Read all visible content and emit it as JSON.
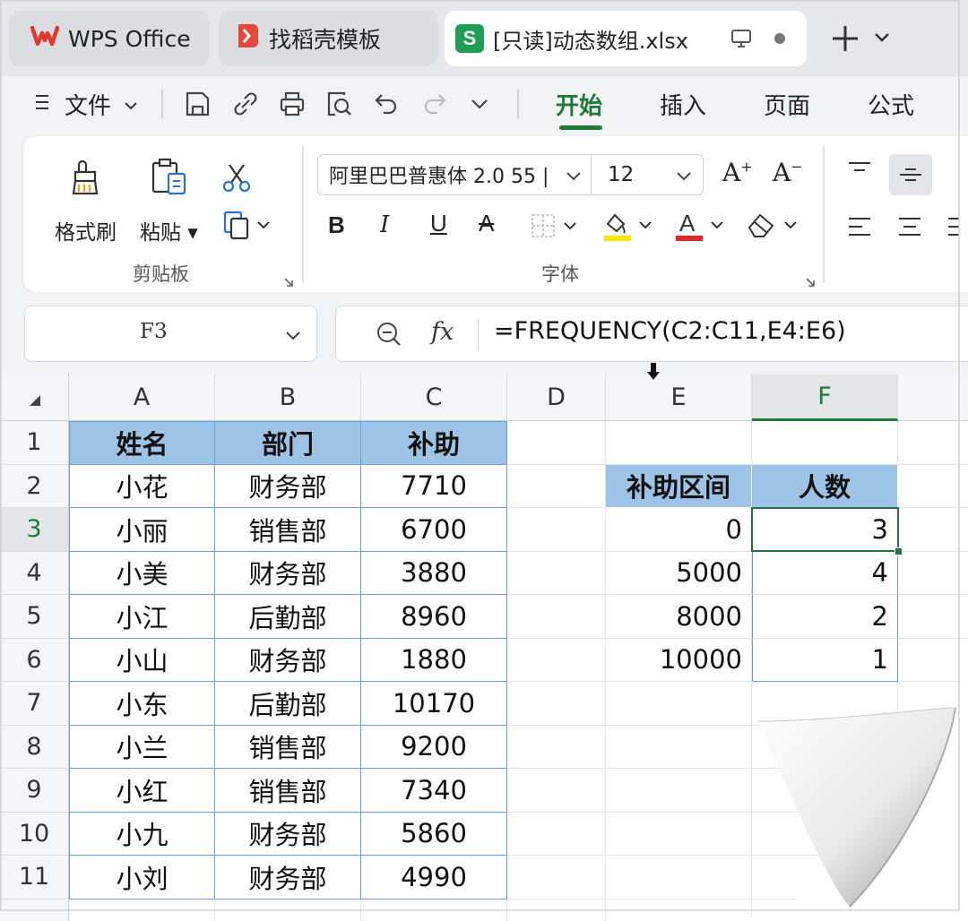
{
  "tabs": [
    {
      "label": "WPS Office",
      "icon": "wps-logo-icon"
    },
    {
      "label": "找稻壳模板",
      "icon": "docer-logo-icon"
    },
    {
      "label": "[只读]动态数组.xlsx",
      "icon": "spreadsheet-s-icon",
      "badge": "S"
    }
  ],
  "menu": {
    "file": "文件",
    "tabs": [
      "开始",
      "插入",
      "页面",
      "公式"
    ],
    "active_tab": "开始"
  },
  "ribbon": {
    "clipboard": {
      "format_painter": "格式刷",
      "paste": "粘贴",
      "group": "剪贴板"
    },
    "font": {
      "name": "阿里巴巴普惠体 2.0 55 |",
      "size": "12",
      "group": "字体",
      "bold": "B",
      "italic": "I",
      "underline": "U",
      "strike": "A",
      "increase": "A",
      "decrease": "A",
      "font_color": "A"
    }
  },
  "formula_bar": {
    "cell_ref": "F3",
    "fx": "fx",
    "formula": "=FREQUENCY(C2:C11,E4:E6)"
  },
  "columns": [
    "A",
    "B",
    "C",
    "D",
    "E",
    "F"
  ],
  "selected_column": "F",
  "selected_row": "3",
  "rows": [
    "1",
    "2",
    "3",
    "4",
    "5",
    "6",
    "7",
    "8",
    "9",
    "10",
    "11"
  ],
  "table_main": {
    "headers": [
      "姓名",
      "部门",
      "补助"
    ],
    "rows": [
      [
        "小花",
        "财务部",
        "7710"
      ],
      [
        "小丽",
        "销售部",
        "6700"
      ],
      [
        "小美",
        "财务部",
        "3880"
      ],
      [
        "小江",
        "后勤部",
        "8960"
      ],
      [
        "小山",
        "财务部",
        "1880"
      ],
      [
        "小东",
        "后勤部",
        "10170"
      ],
      [
        "小兰",
        "销售部",
        "9200"
      ],
      [
        "小红",
        "销售部",
        "7340"
      ],
      [
        "小九",
        "财务部",
        "5860"
      ],
      [
        "小刘",
        "财务部",
        "4990"
      ]
    ]
  },
  "table_freq": {
    "headers": [
      "补助区间",
      "人数"
    ],
    "rows": [
      [
        "0",
        "3"
      ],
      [
        "5000",
        "4"
      ],
      [
        "8000",
        "2"
      ],
      [
        "10000",
        "1"
      ]
    ]
  },
  "colors": {
    "accent": "#1f7a3a",
    "header_fill": "#9dc3e6",
    "table_border": "#6f9fd2",
    "selection": "#217346"
  }
}
